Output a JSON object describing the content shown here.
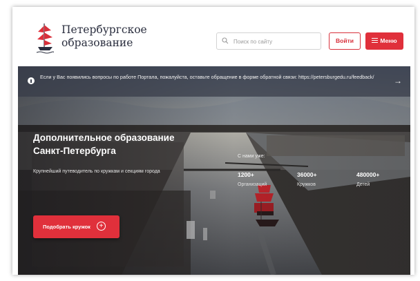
{
  "header": {
    "brand_line1": "Петербургское",
    "brand_line2": "образование",
    "search_placeholder": "Поиск по сайту",
    "login_label": "Войти",
    "menu_label": "Меню"
  },
  "notice": {
    "text": "Если у Вас появились вопросы по работе Портала, пожалуйста, оставьте обращение в форме обратной связи: https://petersburgedu.ru/feedback/",
    "arrow": "→"
  },
  "hero": {
    "title_line1": "Дополнительное образование",
    "title_line2": "Санкт-Петербурга",
    "subtitle": "Крупнейший путеводитель по кружкам и секциям города",
    "stats_heading": "С нами уже:",
    "stats": [
      {
        "value": "1200+",
        "label": "Организаций"
      },
      {
        "value": "36000+",
        "label": "Кружков"
      },
      {
        "value": "480000+",
        "label": "Детей"
      }
    ],
    "cta_label": "Подобрать кружок",
    "cta_icon": "+"
  },
  "colors": {
    "accent": "#e0303b",
    "brand_text": "#2b2f3f",
    "notice_bg": "#373c48"
  },
  "icons": [
    "ship-logo-icon",
    "search-icon",
    "menu-icon",
    "info-icon",
    "arrow-right-icon",
    "plus-circle-icon"
  ]
}
